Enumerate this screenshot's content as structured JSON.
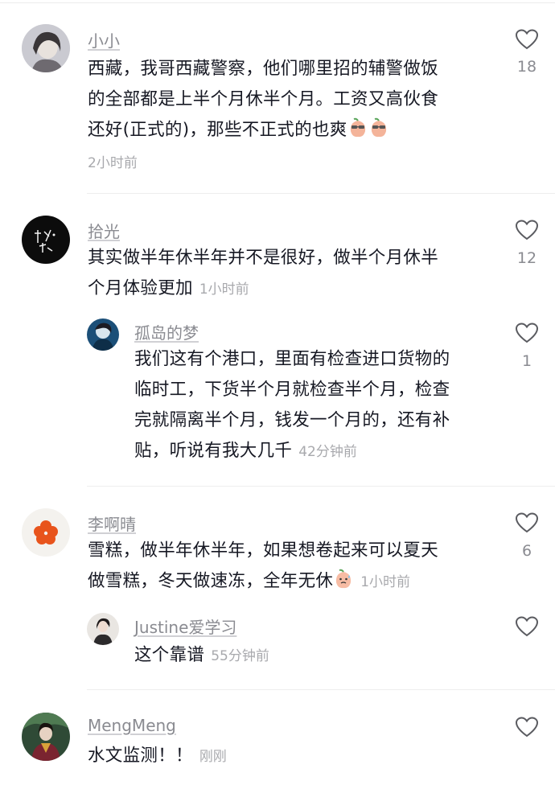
{
  "comments": [
    {
      "user": "小小",
      "text_lines": [
        "西藏，我哥西藏警察，他们哪里招的辅警做饭",
        "的全部都是上半个月休半个月。工资又高伙食",
        "还好(正式的)，那些不正式的也爽"
      ],
      "time": "2小时前",
      "likes": "18",
      "emojis": [
        "peach-glasses-emoji",
        "peach-glasses-emoji"
      ]
    },
    {
      "user": "拾光",
      "text_lines": [
        "其实做半年休半年并不是很好，做半个月休半",
        "个月体验更加"
      ],
      "time": "1小时前",
      "likes": "12",
      "reply": {
        "user": "孤岛的梦",
        "text_lines": [
          "我们这有个港口，里面有检查进口货物的",
          "临时工，下货半个月就检查半个月，检查",
          "完就隔离半个月，钱发一个月的，还有补",
          "贴，听说有我大几千"
        ],
        "time": "42分钟前",
        "likes": "1"
      }
    },
    {
      "user": "李啊晴",
      "text_lines": [
        "雪糕，做半年休半年，如果想卷起来可以夏天",
        "做雪糕，冬天做速冻，全年无休"
      ],
      "time": "1小时前",
      "likes": "6",
      "emojis": [
        "peach-sweat-emoji"
      ],
      "reply": {
        "user": "Justine爱学习",
        "text_lines": [
          "这个靠谱"
        ],
        "time": "55分钟前",
        "likes": ""
      }
    },
    {
      "user": "MengMeng",
      "text_lines": [
        "水文监测！！"
      ],
      "time": "刚刚",
      "likes": ""
    }
  ]
}
